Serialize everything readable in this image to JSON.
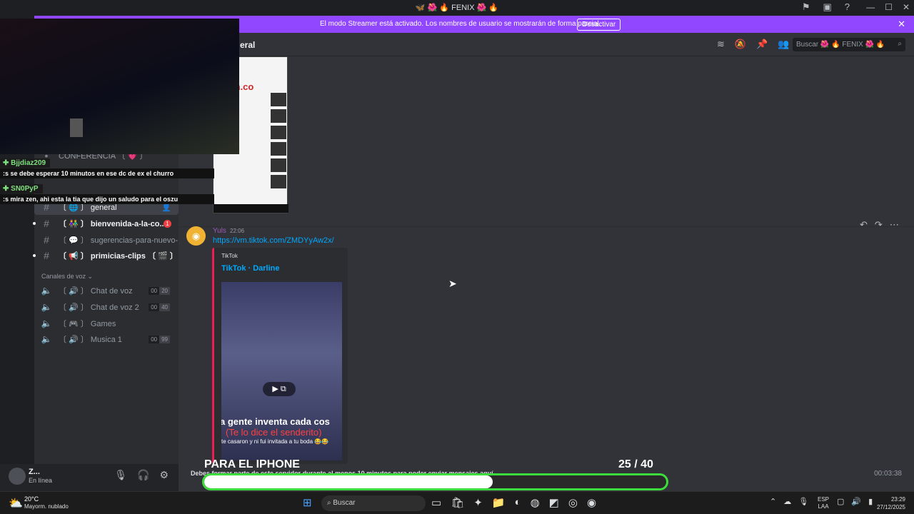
{
  "window": {
    "title": "🦋 🌺 🔥 FENIX 🌺 🔥",
    "min": "—",
    "max": "☐",
    "close": "✕"
  },
  "banner": {
    "text": "El modo Streamer está activado. Los nombres de usuario se mostrarán de forma parcial.",
    "button": "Desactivar",
    "close": "✕"
  },
  "header": {
    "channel": "eral",
    "search_placeholder": "Buscar 🌺 🔥 FENIX 🌺 🔥"
  },
  "sidebar": {
    "channels": [
      {
        "label": "CONFERENCIA 〔 💗 〕",
        "icon": "•",
        "top": 0
      },
      {
        "label": "〔 🌐 〕 general",
        "icon": "#"
      },
      {
        "label": "〔 👫 〕 bienvenida-a-la-co...",
        "icon": "#",
        "badge": "1"
      },
      {
        "label": "〔 💬 〕 sugerencias-para-nuevo-...",
        "icon": "#"
      },
      {
        "label": "〔 📢 〕 primicias-clips 〔 🎬 〕",
        "icon": "#"
      }
    ],
    "voice_header": "Canales de voz ⌄",
    "voice": [
      {
        "label": "〔 🔊 〕 Chat de voz",
        "count": "00",
        "limit": "20"
      },
      {
        "label": "〔 🔊 〕 Chat de voz 2",
        "count": "00",
        "limit": "40"
      },
      {
        "label": "〔 🎮 〕 Games"
      },
      {
        "label": "〔 🔊 〕 Musica 1",
        "count": "00",
        "limit": "99"
      }
    ]
  },
  "user": {
    "name": "Z...",
    "status": "En línea"
  },
  "message": {
    "author": "Yuls",
    "time": "22:06",
    "link": "https://vm.tiktok.com/ZMDYyAw2x/",
    "provider": "TikTok",
    "embed_title": "TikTok · Darline",
    "caption1": "a gente inventa cada cos",
    "caption2": "(Te lo dice el senderito)",
    "caption3": "te casaron y ni fui invitada a tu boda 😂😂"
  },
  "phone": {
    "site": "citeen.co"
  },
  "chat_overlay": [
    {
      "user": "✚ Bjjdiaz209",
      "msg": ":s se debe esperar 10 minutos en ese dc de ex el churro"
    },
    {
      "user": "✚ SN0PyP",
      "msg": ":s mira zen, ahi esta la tia que dijo un saludo para el oszu"
    }
  ],
  "bottom": {
    "notice": "Debes formar parte de este servidor durante al menos 10 minutos para poder enviar mensajes aquí.",
    "timer": "00:03:38"
  },
  "goal": {
    "title": "PARA EL IPHONE",
    "count": "25  / 40",
    "current": 25,
    "target": 40
  },
  "taskbar": {
    "temp": "20°C",
    "weather": "Mayorm. nublado",
    "search": "Buscar",
    "lang1": "ESP",
    "lang2": "LAA",
    "time": "23:29",
    "date": "27/12/2025"
  },
  "colors": {
    "accent": "#9146ff",
    "goal": "#3ddc3d",
    "link": "#00a8fc"
  }
}
